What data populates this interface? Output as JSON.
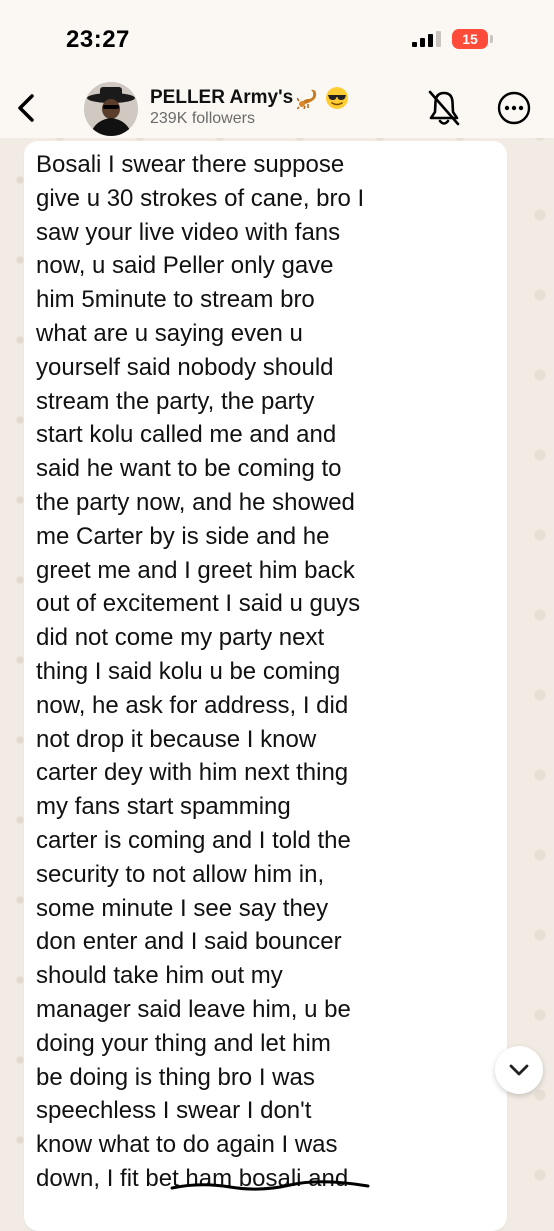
{
  "status_bar": {
    "time": "23:27",
    "battery_level": "15",
    "signal_icon": "cellular-signal-icon"
  },
  "header": {
    "back_icon": "chevron-left-icon",
    "channel_name": "PELLER Army's",
    "channel_emojis": [
      "scorpion-emoji",
      "sunglasses-face-emoji"
    ],
    "followers": "239K followers",
    "mute_icon": "bell-slash-icon",
    "more_icon": "more-options-icon"
  },
  "message": {
    "text": "Bosali I swear there suppose\ngive u 30 strokes of cane, bro I\nsaw your live video with fans\nnow, u said Peller only gave\nhim 5minute to stream bro\nwhat are u saying even u\nyourself said nobody should\nstream the party, the party\nstart kolu called me and and\nsaid he want to be coming to\nthe party now, and he showed\nme Carter by is side and he\ngreet me and I greet him back\nout of excitement I said u guys\ndid not come my party next\nthing I said kolu u be coming\nnow, he ask for address, I did\nnot drop it because I know\ncarter dey with him next thing\nmy fans start spamming\ncarter is coming and I told the\nsecurity to not allow him in,\nsome minute I see say they\ndon enter and I said bouncer\nshould take him out my\nmanager said leave him, u be\ndoing your thing and let him\nbe doing is thing bro I was\nspeechless I swear I don't\nknow what to do again I was\ndown, I fit bet ham bosali and"
  },
  "scroll_button_icon": "chevron-down-icon",
  "colors": {
    "background": "#f1ebe3",
    "bubble": "#ffffff",
    "battery": "#ff4b3a",
    "text": "#111111",
    "secondary_text": "#6b6b6b"
  }
}
